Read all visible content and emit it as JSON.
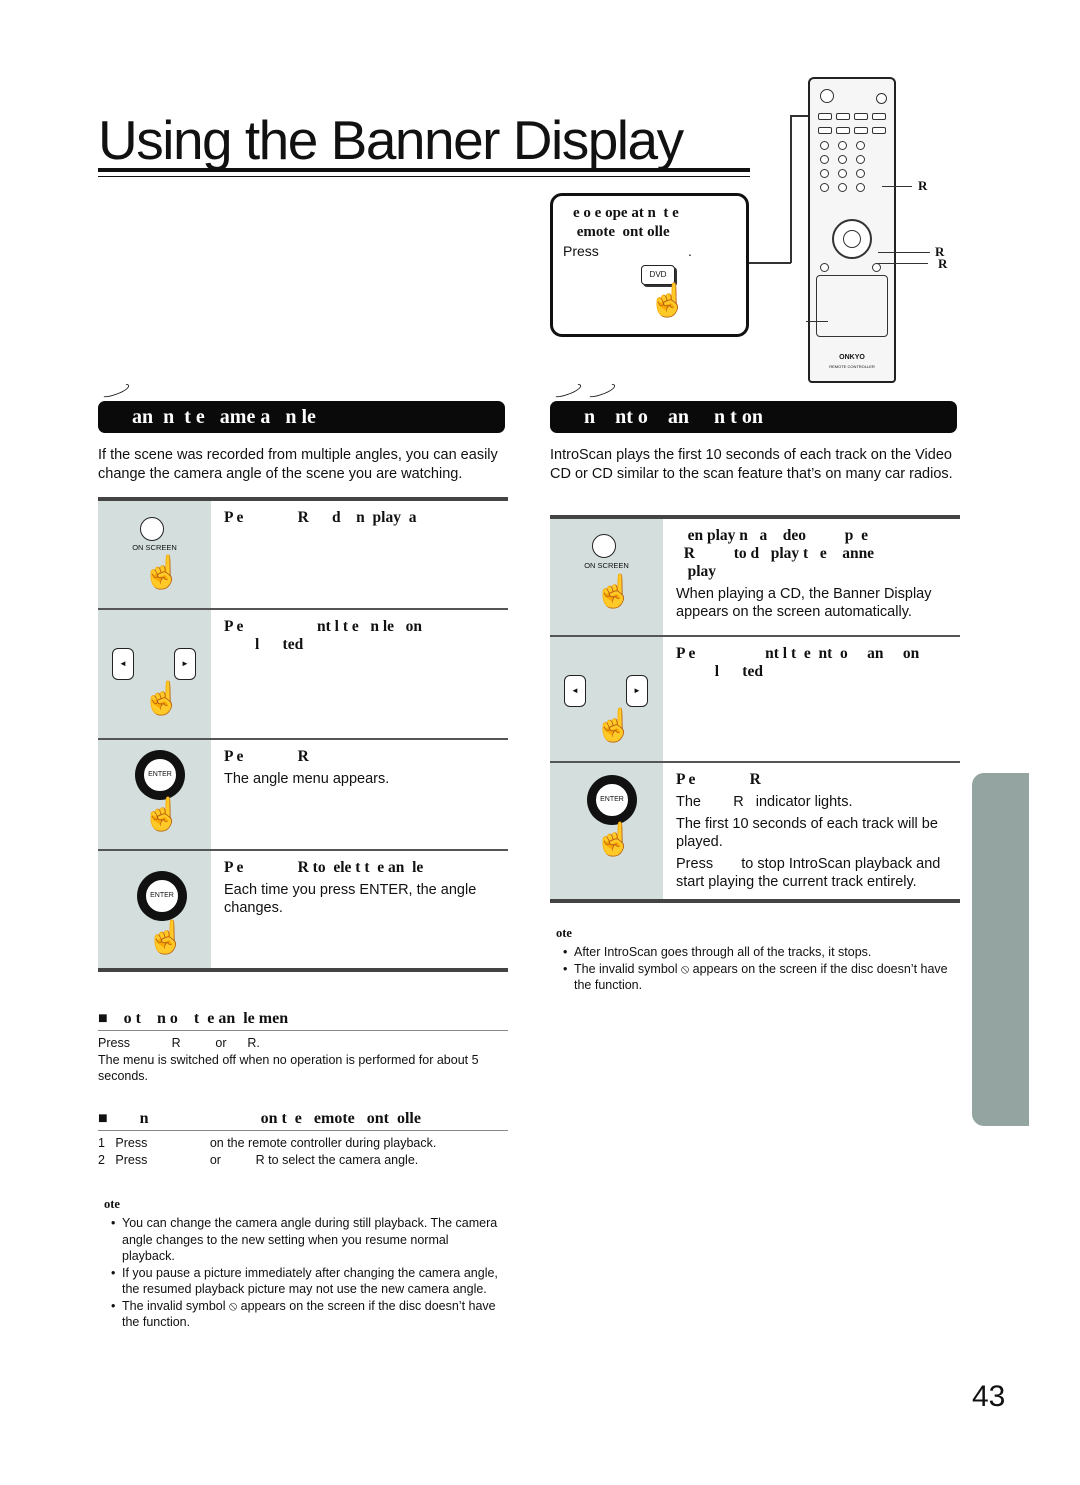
{
  "page": {
    "title": "Using the Banner Display",
    "page_number": "43"
  },
  "callout": {
    "heading": "e o e ope at n  t e\n emote  ont olle",
    "press": "Press",
    "period": ".",
    "button": "DVD"
  },
  "remote": {
    "brand": "ONKYO",
    "model": "REMOTE CONTROLLER",
    "labels": [
      "R",
      "R",
      "R"
    ]
  },
  "left": {
    "section_bar": "an  n  t e   ame a   n le",
    "intro": "If the scene was recorded from multiple angles, you can easily change the camera angle of the scene you are watching.",
    "steps": [
      {
        "heading": "P e              R      d    n  play  a",
        "icon": "ON SCREEN"
      },
      {
        "heading": "P e                   nt l t e   n le   on\n        l      ted"
      },
      {
        "heading": "P e              R",
        "body": "The angle menu appears.",
        "icon": "ENTER"
      },
      {
        "heading": "P e              R to  ele t t  e an  le",
        "body": "Each time you press ENTER, the angle changes.",
        "icon": "ENTER"
      }
    ],
    "sub1": {
      "heading": "    o t    n o    t  e an  le men",
      "line1": "Press            R          or      R.",
      "line2": "The menu is switched off when no operation is performed for about 5 seconds."
    },
    "sub2": {
      "heading": "        n                            on t  e   emote   ont  olle",
      "items": [
        "1   Press                  on the remote controller during playback.",
        "2   Press                  or          R to select the camera angle."
      ]
    },
    "note": {
      "heading": "ote",
      "items": [
        "You can change the camera angle during still playback. The camera angle changes to the new setting when you resume normal playback.",
        "If you pause a picture immediately after changing the camera angle, the resumed playback picture may not use the new camera angle.",
        "The invalid symbol ⦸ appears on the screen if the disc doesn’t have the function."
      ]
    }
  },
  "right": {
    "section_bar": "n    nt o    an     n t on",
    "intro": "IntroScan plays the first 10 seconds of each track on the Video CD or CD similar to the scan feature that’s on many car radios.",
    "steps": [
      {
        "heading": "   en play n   a    deo          p  e\n  R          to d   play t   e    anne\n   play",
        "body": "When playing a CD, the Banner Display appears on the screen automatically.",
        "icon": "ON SCREEN"
      },
      {
        "heading": "P e                  nt l t  e  nt  o     an     on\n          l      ted"
      },
      {
        "heading": "P e              R",
        "body1": "The        R   indicator lights.",
        "body2": "The first 10 seconds of each track will be played.",
        "body3": "Press       to stop IntroScan playback and start playing the current track entirely.",
        "icon": "ENTER"
      }
    ],
    "note": {
      "heading": "ote",
      "items": [
        "After IntroScan goes through all of the tracks, it stops.",
        "The invalid symbol ⦸ appears on the screen if the disc doesn’t have the function."
      ]
    }
  },
  "colors": {
    "step_icon_bg": "#d3dedd",
    "side_tab": "#94a5a1",
    "bar": "#0a0a0a"
  }
}
